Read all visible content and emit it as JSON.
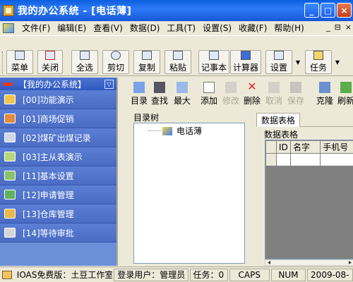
{
  "window": {
    "title": "我的办公系统 - [电话薄]",
    "controls": [
      "_",
      "□",
      "×"
    ]
  },
  "menubar": {
    "items": [
      "文件(F)",
      "编辑(E)",
      "查看(V)",
      "数据(D)",
      "工具(T)",
      "设置(S)",
      "收藏(F)",
      "帮助(H)"
    ],
    "mdi_controls": [
      "_",
      "⊟",
      "×"
    ]
  },
  "toolbar": {
    "buttons": [
      "菜单",
      "关闭",
      "全选",
      "剪切",
      "复制",
      "粘贴",
      "记事本",
      "计算器",
      "设置",
      "任务"
    ]
  },
  "left_panel": {
    "header": "【我的办公系统】",
    "items": [
      "[00]功能演示",
      "[01]商场促销",
      "[02]煤矿出煤记录",
      "[03]主从表演示",
      "[11]基本设置",
      "[12]申请管理",
      "[13]仓库管理",
      "[14]等待审批"
    ]
  },
  "content_toolbar": {
    "buttons": [
      "目录",
      "查找",
      "最大",
      "添加",
      "修改",
      "删除",
      "取消",
      "保存",
      "克隆",
      "刷新"
    ]
  },
  "tree": {
    "label": "目录树",
    "root": "电话薄"
  },
  "grid": {
    "tab": "数据表格",
    "group": "数据表格",
    "columns": [
      "",
      "ID",
      "名字",
      "手机号"
    ]
  },
  "statusbar": {
    "edition": "IOAS免费版：土豆工作室",
    "user": "登录用户：管理员",
    "tasks": "任务：0",
    "caps": "CAPS",
    "num": "NUM",
    "date": "2009-08-"
  },
  "colors": {
    "titlebar": "#0a5fe0",
    "nav": "#4a6cc4",
    "accent_red": "#e0382c"
  }
}
